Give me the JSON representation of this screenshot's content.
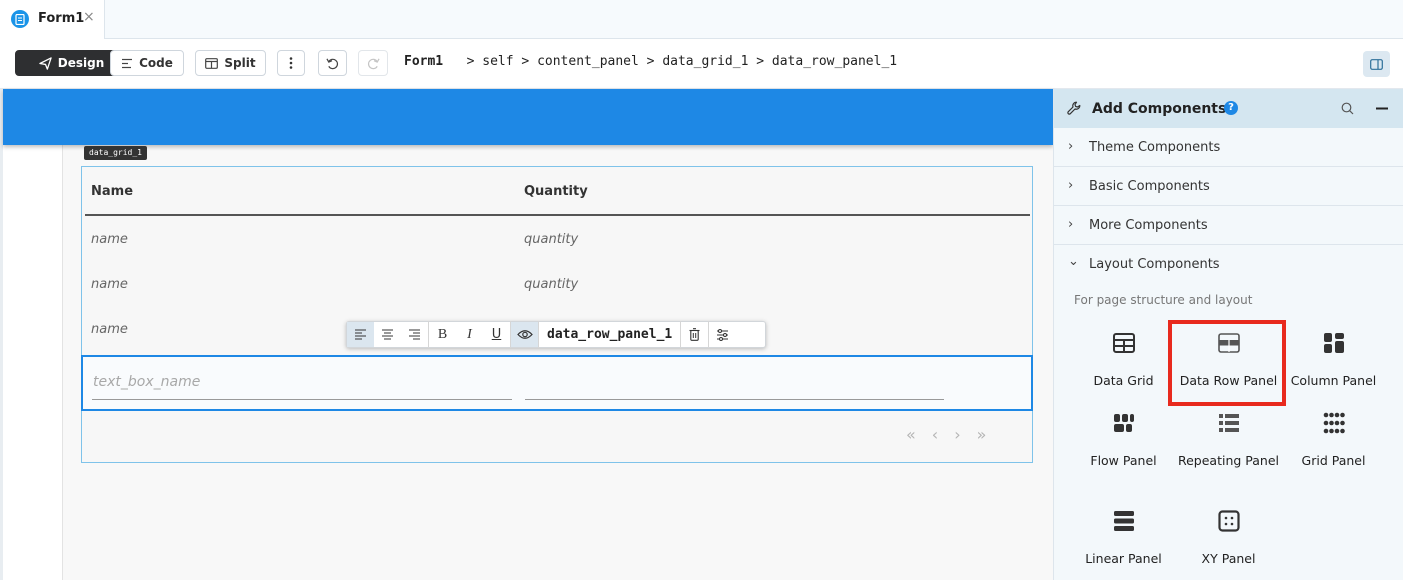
{
  "tab": {
    "label": "Form1",
    "close": "×"
  },
  "toolbar": {
    "design": "Design",
    "code": "Code",
    "split": "Split"
  },
  "breadcrumb": {
    "root": "Form1",
    "items": [
      "self",
      "content_panel",
      "data_grid_1",
      "data_row_panel_1"
    ],
    "sep": ">"
  },
  "grid": {
    "tag": "data_grid_1",
    "columns": [
      "Name",
      "Quantity"
    ],
    "rows": [
      [
        "name",
        "quantity"
      ],
      [
        "name",
        "quantity"
      ],
      [
        "name",
        ""
      ]
    ],
    "textbox_placeholder": "text_box_name"
  },
  "floatbar": {
    "component_name": "data_row_panel_1"
  },
  "sidebar": {
    "title": "Add Components",
    "help": "?",
    "sections": [
      "Theme Components",
      "Basic Components",
      "More Components",
      "Layout Components"
    ],
    "layout_description": "For page structure and layout",
    "components": [
      {
        "label": "Data Grid",
        "icon": "data-grid-icon"
      },
      {
        "label": "Data Row Panel",
        "icon": "data-row-panel-icon",
        "highlighted": true
      },
      {
        "label": "Column Panel",
        "icon": "column-panel-icon"
      },
      {
        "label": "Flow Panel",
        "icon": "flow-panel-icon"
      },
      {
        "label": "Repeating Panel",
        "icon": "repeating-panel-icon"
      },
      {
        "label": "Grid Panel",
        "icon": "grid-panel-icon"
      },
      {
        "label": "Linear Panel",
        "icon": "linear-panel-icon"
      },
      {
        "label": "XY Panel",
        "icon": "xy-panel-icon"
      }
    ]
  },
  "colors": {
    "accent": "#1e88e5",
    "highlight": "#e82a1e",
    "dark_button": "#2e2f31"
  }
}
